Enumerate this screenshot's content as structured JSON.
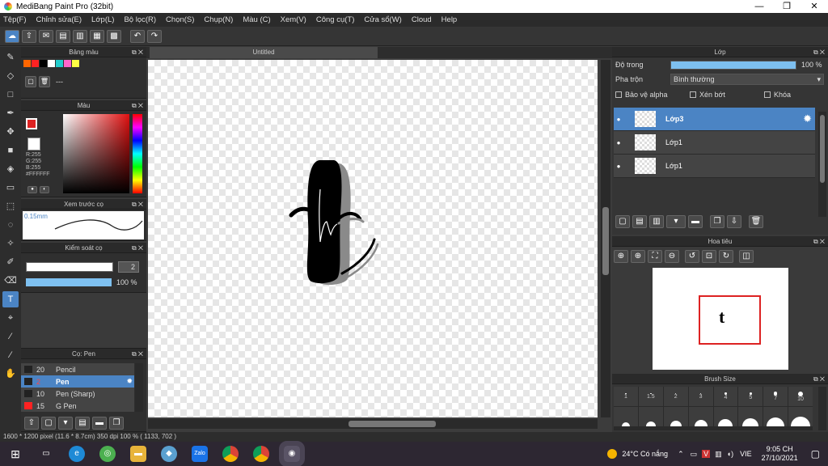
{
  "window": {
    "title": "MediBang Paint Pro (32bit)",
    "minimize": "—",
    "maximize": "❐",
    "close": "✕"
  },
  "menu": [
    "Tệp(F)",
    "Chỉnh sửa(E)",
    "Lớp(L)",
    "Bộ lọc(R)",
    "Chọn(S)",
    "Chụp(N)",
    "Màu (C)",
    "Xem(V)",
    "Công cụ(T)",
    "Cửa sổ(W)",
    "Cloud",
    "Help"
  ],
  "canvas": {
    "tab_title": "Untitled"
  },
  "panels": {
    "palette": {
      "title": "Bảng màu",
      "label": "---",
      "swatches": [
        "#ff6600",
        "#ff2222",
        "#000000",
        "#ffffff",
        "#22cccc",
        "#ff66cc",
        "#ffff44"
      ]
    },
    "color": {
      "title": "Màu",
      "r": "R:255",
      "g": "G:255",
      "b": "B:255",
      "hex": "#FFFFFF"
    },
    "preview": {
      "title": "Xem trước cọ",
      "size": "0.15mm"
    },
    "brush_control": {
      "title": "Kiểm soát cọ",
      "size": "2",
      "opacity": "100 %"
    },
    "brush": {
      "title": "Cọ: Pen",
      "items": [
        {
          "size": "20",
          "name": "Pencil",
          "color": "#000000"
        },
        {
          "size": "2",
          "name": "Pen",
          "color": "#000000"
        },
        {
          "size": "10",
          "name": "Pen (Sharp)",
          "color": "#000000"
        },
        {
          "size": "15",
          "name": "G Pen",
          "color": "#ff2222"
        }
      ]
    },
    "layer": {
      "title": "Lớp",
      "opacity_label": "Độ trong",
      "opacity_value": "100 %",
      "opacity": 1.0,
      "blend_label": "Pha trộn",
      "blend_value": "Bình thường",
      "protect_alpha": "Bảo vệ alpha",
      "clipping": "Xén bớt",
      "lock": "Khóa",
      "layers": [
        {
          "name": "Lớp3",
          "selected": true
        },
        {
          "name": "Lớp1",
          "selected": false
        },
        {
          "name": "Lớp1",
          "selected": false
        }
      ]
    },
    "navigator": {
      "title": "Hoa tiêu"
    },
    "brush_size": {
      "title": "Brush Size",
      "sizes": [
        "1",
        "1.5",
        "2",
        "3",
        "4",
        "5",
        "7",
        "10"
      ]
    }
  },
  "status": {
    "text": "1600 * 1200 pixel   (11.6 * 8.7cm)   350 dpi   100 %   ( 1133, 702 )"
  },
  "taskbar": {
    "weather": "24°C  Có nắng",
    "lang": "VIE",
    "time": "9:05 CH",
    "date": "27/10/2021"
  }
}
